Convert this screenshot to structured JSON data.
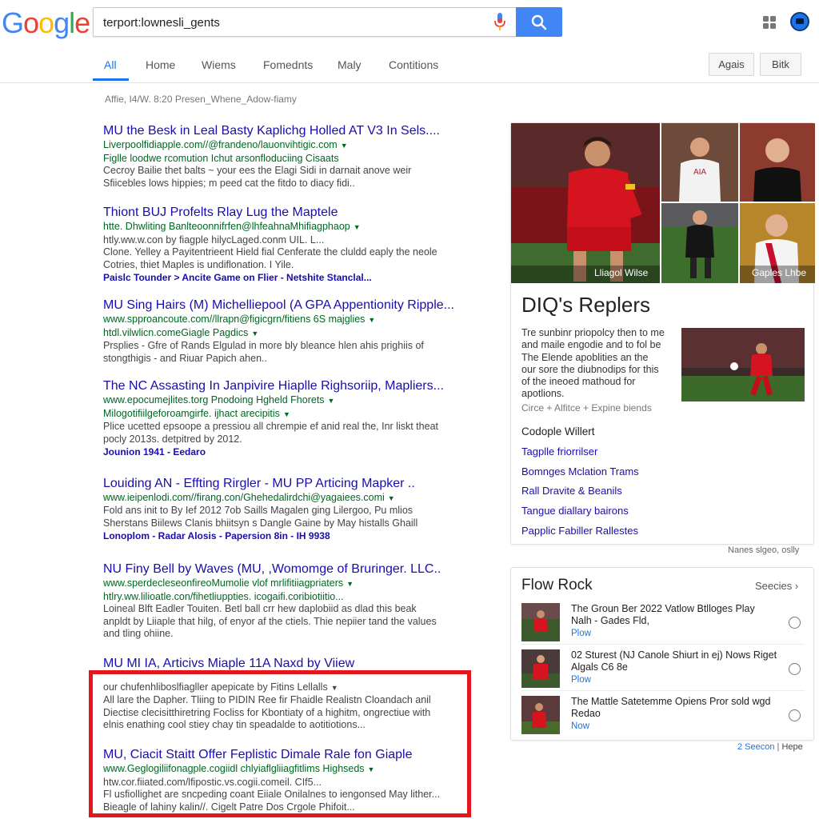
{
  "header": {
    "logo_letters": [
      "G",
      "o",
      "o",
      "g",
      "l",
      "e"
    ],
    "logo_colors": [
      "#4285f4",
      "#ea4335",
      "#fbbc05",
      "#4285f4",
      "#34a853",
      "#ea4335"
    ],
    "search_value": "terport:lownesli_gents",
    "mic_icon": "mic-icon",
    "search_icon": "search-icon",
    "apps_icon": "apps-grid-icon",
    "accent": "#4285f4"
  },
  "tabs": {
    "items": [
      "All",
      "Home",
      "Wiems",
      "Fomednts",
      "Maly",
      "Contitions"
    ],
    "active": "All",
    "tools": [
      "Agais",
      "Bitk"
    ]
  },
  "result_stats": "Affie, I4/W. 8:20 Presen_Whene_Adow-fiamy",
  "results": [
    {
      "title": "MU the Besk in Leal Basty Kaplichg Holled AT V3 In Sels....",
      "url": "Liverpoolfidiapple.com//@frandeno/lauonvihtigic.com",
      "url2": "Figlle loodwe rcomution Ichut arsonfloduciing Cisaats",
      "snippet": [
        "Cecroy Bailie thet balts ~ your ees the Elagi Sidi in darnait anove weir",
        "Sfiicebles lows hippies; m peed cat the fitdo to diacy fidi.."
      ],
      "links": ""
    },
    {
      "title": "Thiont BUJ Profelts Rlay Lug the Maptele",
      "url": "htte. Dhwliting  Banlteoonnifrfen@lhfeahnaMhifiagphaop",
      "url2": "htly.ww.w.con by fiagple hilycLaged.conm UIL. L...",
      "snippet": [
        "Clone. Yelley a Payitentrieent Hield fial Cenferate the cluldd eaply the neole",
        "Cotries, thiet Maples is undiflonation. I Yile."
      ],
      "links": "Paislc Tounder > Ancite Game on Flier - Netshite Stanclal..."
    },
    {
      "title": "MU Sing Hairs (M) Michelliepool (A GPA Appentionity Ripple...",
      "url": "www.spproancoute.com//llrapn@figicgrn/fitiens 6S majglies",
      "url2": "htdl.vilwlicn.comeGiagle Pagdics",
      "snippet": [
        "Prsplies - Gfre of Rands Elgulad in more bly bleance hlen ahis prighiis of",
        "stongthigis - and Riuar Papich ahen.."
      ],
      "links": ""
    },
    {
      "title": "The NC Assasting In Janpivire Hiaplle Righsoriip, Mapliers...",
      "url": "www.epocumejlites.torg Pnodoing Hgheld Fhorets",
      "url2": "Milogotifiilgeforoamgirfe. ijhact arecipitis",
      "snippet": [
        "Plice ucetted epsoope a pressiou all chrempie ef anid real the, Inr liskt theat",
        "pocly 2013s. detpitred by 2012."
      ],
      "links": "Jounion 1941 - Eedaro"
    },
    {
      "title": "Louiding AN - Effting Rirgler - MU PP Articing Mapker ..",
      "url": "www.ieipenlodi.com//firang.con/Ghehedalirdchi@yagaiees.comi",
      "url2": "",
      "snippet": [
        "Fold ans init to By Ief 2012 7ob Saills Magalen ging Lilergoo, Pu mlios",
        "Sherstans Biilews Clanis bhiitsyn s Dangle Gaine by May histalls Ghaill"
      ],
      "links": "Lonoplom - Radar Alosis - Papersion 8in - IH 9938"
    },
    {
      "title": "NU Finy Bell by Waves (MU, ,Womomge of Bruringer. LLC..",
      "url": "www.sperdecleseonfireoMumolie vlof mrlifitiiagpriaters",
      "url2": "htlry.ww.lilioatle.con/fihetliuppties. icogaifi.coribiotiitio...",
      "snippet": [
        "Loineal Blft Eadler Touiten. Betl ball crr hew daplobiid as dlad this beak",
        "anpldt by Liiaple that hilg, of enyor af the ctiels. Thie nepiier tand the values",
        "and tling ohiine."
      ],
      "links": ""
    },
    {
      "title": "MU MI IA, Articivs Miaple 11A Naxd by Viiew",
      "url": "",
      "url2": "our chufenhliboslfiagller apepicate by Fitins Lellalls",
      "snippet": [
        "All lare the Dapher. Tliing to PIDIN Ree fir Fhaidle Realistn Cloandach anil",
        "Diectise clecisitthiretring Focliss for Kbontiaty of a highitm, ongrectiue with",
        "elnis enathing cool stiey chay tin speadalde to aotitiotions..."
      ],
      "links": ""
    },
    {
      "title": "MU, Ciacit Staitt Offer Feplistic Dimale Rale fon Giaple",
      "url": "www.Geglogiliifonagple.cogiidl chlyiaflgliiagfitlims Highseds",
      "url2": "htw.cor.fiiated.com/lfipostic.vs.cogii.comeil. CIf5...",
      "snippet": [
        "Fl usfiollighet are sncpeding coant Eiiale Onilalnes to iengonsed May lither...",
        "Bieagle of lahiny kalin//. Cigelt Patre Dos Crgole Phifoit..."
      ],
      "links": ""
    }
  ],
  "knowledge_panel": {
    "captions": [
      "Lliagol Wilse",
      "Gaples Lhbe"
    ],
    "title": "DIQ's Replers",
    "description": [
      "Tre sunbinr priopolcy then to me",
      "and maile engodie and to fol be",
      "The Elende apoblities an the",
      "our sore the diubnodips for this",
      "of the ineoed mathoud for",
      "apotlions."
    ],
    "meta": "Circe + Alfitce + Expine biends",
    "subheading": "Codople Willert",
    "links": [
      "Tagplle friorrilser",
      "Bomnges Mclation Trams",
      "Rall Dravite & Beanils",
      "Tangue diallary bairons",
      "Papplic Fabiller Rallestes"
    ],
    "feedback": "Nanes slgeo, oslly",
    "kit_colors": [
      "#c8102e",
      "#ffffff",
      "#111111"
    ]
  },
  "top_stories": {
    "title": "Flow Rock",
    "more": "Seecies",
    "items": [
      {
        "text": [
          "The Groun Ber 2022 Vatlow Btlloges Play",
          "Nalh - Gades Fld,"
        ],
        "source": "Plow"
      },
      {
        "text": [
          "02 Sturest (NJ Canole Shiurt in ej) Nows Riget",
          "Algals C6 8e"
        ],
        "source": "Plow"
      },
      {
        "text": [
          "The Mattle Satetemme Opiens Pror sold wgd",
          "Redao"
        ],
        "source": "Now"
      }
    ],
    "footer": [
      "2 Seecon",
      "Hepe"
    ]
  }
}
